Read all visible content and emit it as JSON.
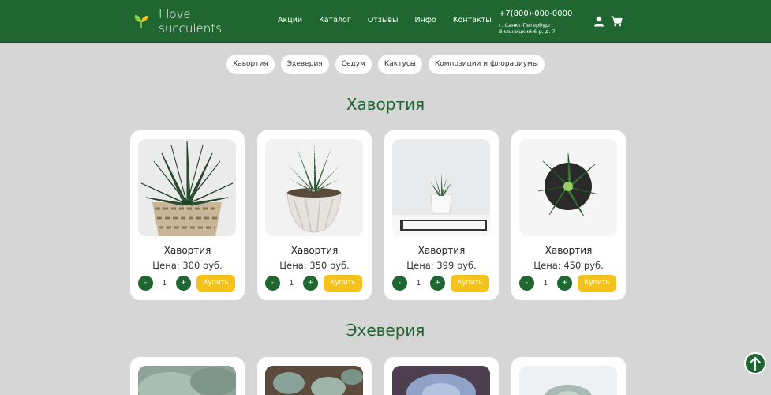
{
  "header": {
    "logo_line1": "I love",
    "logo_line2": "succulents",
    "nav": [
      "Акции",
      "Каталог",
      "Отзывы",
      "Инфо",
      "Контакты"
    ],
    "phone": "+7(800)-000-0000",
    "address": "г. Санкт-Петербург, Вильницкий 6-р, д. 7",
    "icons": [
      "user-icon",
      "cart-icon"
    ]
  },
  "filters": [
    "Хавортия",
    "Эхеверия",
    "Седум",
    "Кактусы",
    "Композиции и флорариумы"
  ],
  "sections": [
    {
      "title": "Хавортия",
      "products": [
        {
          "name": "Хавортия",
          "price": "Цена: 300 руб.",
          "qty": "1",
          "minus": "-",
          "plus": "+",
          "buy": "Купить"
        },
        {
          "name": "Хавортия",
          "price": "Цена: 350 руб.",
          "qty": "1",
          "minus": "-",
          "plus": "+",
          "buy": "Купить"
        },
        {
          "name": "Хавортия",
          "price": "Цена: 399 руб.",
          "qty": "1",
          "minus": "-",
          "plus": "+",
          "buy": "Купить"
        },
        {
          "name": "Хавортия",
          "price": "Цена: 450 руб.",
          "qty": "1",
          "minus": "-",
          "plus": "+",
          "buy": "Купить"
        }
      ]
    },
    {
      "title": "Эхеверия"
    }
  ],
  "colors": {
    "brand": "#1f6630",
    "accent": "#f5c21b",
    "background": "#d6d6d6"
  },
  "scroll_top_icon": "arrow-up-icon"
}
